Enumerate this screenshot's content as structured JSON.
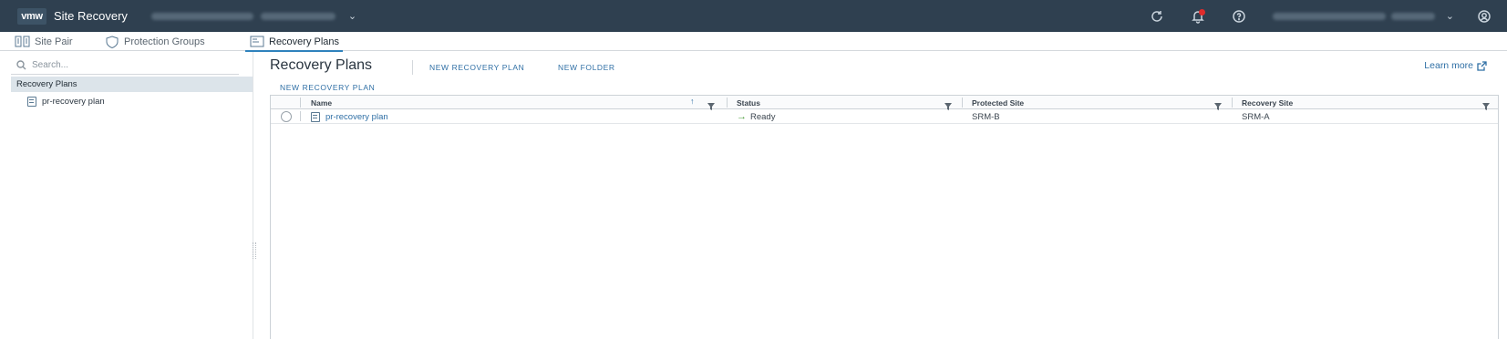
{
  "header": {
    "logo_text": "vmw",
    "app_title": "Site Recovery",
    "vcenter_caret": "⌄",
    "user_caret": "⌄",
    "icons": [
      "refresh-icon",
      "bell-icon",
      "help-icon",
      "user-icon"
    ]
  },
  "tabs": [
    {
      "label": "Site Pair",
      "icon": "site-pair-icon"
    },
    {
      "label": "Protection Groups",
      "icon": "shield-icon"
    },
    {
      "label": "Recovery Plans",
      "icon": "recovery-plan-icon",
      "active": true
    }
  ],
  "sidebar": {
    "search_placeholder": "Search...",
    "tree_root": "Recovery Plans",
    "tree_children": [
      "pr-recovery plan"
    ]
  },
  "main": {
    "title": "Recovery Plans",
    "actions": {
      "new_plan": "NEW RECOVERY PLAN",
      "new_folder": "NEW FOLDER"
    },
    "learn_more": "Learn more",
    "grid_action": "NEW RECOVERY PLAN",
    "columns": [
      "Name",
      "Status",
      "Protected Site",
      "Recovery Site"
    ],
    "rows": [
      {
        "name": "pr-recovery plan",
        "status": "Ready",
        "protected_site": "SRM-B",
        "recovery_site": "SRM-A"
      }
    ]
  },
  "colors": {
    "header_bg": "#2f4050",
    "accent": "#2f82bd",
    "link": "#2f6fa5",
    "ready": "#4b9d3a"
  }
}
